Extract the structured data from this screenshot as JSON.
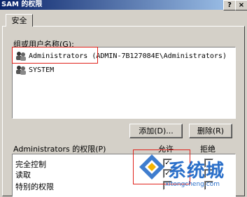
{
  "window": {
    "title": "SAM 的权限",
    "help_glyph": "?",
    "close_glyph": "×"
  },
  "tabs": [
    {
      "label": "安全"
    }
  ],
  "users": {
    "group_label": "组或用户名称(G):",
    "items": [
      {
        "name": "Administrators",
        "detail": " (ADMIN-7B127084E\\Administrators)"
      },
      {
        "name": "SYSTEM",
        "detail": ""
      }
    ]
  },
  "buttons": {
    "add": "添加(D)...",
    "remove": "删除(R)"
  },
  "permissions": {
    "header_label": "Administrators 的权限(P)",
    "allow_header": "允许",
    "deny_header": "拒绝",
    "rows": [
      {
        "label": "完全控制",
        "allow": true,
        "deny": false
      },
      {
        "label": "读取",
        "allow": true,
        "deny": false
      },
      {
        "label": "特别的权限",
        "allow": false,
        "deny": false
      }
    ]
  },
  "watermark": {
    "text": "系统城",
    "url": "xitongcheng.com"
  },
  "colors": {
    "titlebar_start": "#0a246a",
    "highlight_box": "#e0221b",
    "watermark": "#2a6fc9"
  }
}
